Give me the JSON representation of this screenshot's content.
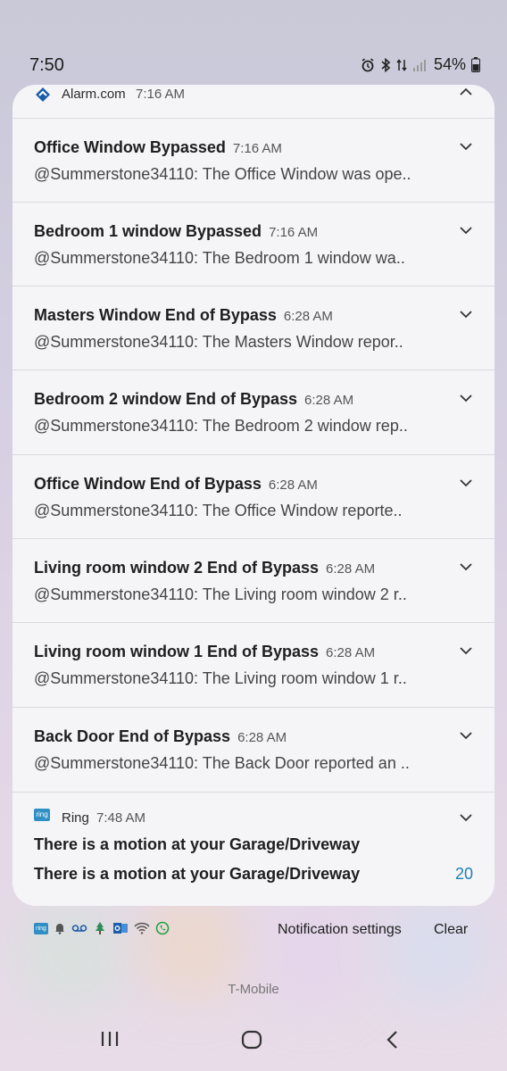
{
  "status_bar": {
    "time": "7:50",
    "battery_percent": "54%",
    "icons": [
      "alarm-icon",
      "bluetooth-icon",
      "data-arrows-icon",
      "signal-icon",
      "battery-icon"
    ]
  },
  "alarm_group": {
    "app_name": "Alarm.com",
    "time": "7:16 AM",
    "notifications": [
      {
        "title": "Office Window Bypassed",
        "time": "7:16 AM",
        "body": "@Summerstone34110: The Office Window was ope.."
      },
      {
        "title": "Bedroom 1 window Bypassed",
        "time": "7:16 AM",
        "body": "@Summerstone34110: The Bedroom 1 window wa.."
      },
      {
        "title": "Masters Window End of Bypass",
        "time": "6:28 AM",
        "body": "@Summerstone34110: The Masters Window repor.."
      },
      {
        "title": "Bedroom 2 window End of Bypass",
        "time": "6:28 AM",
        "body": "@Summerstone34110: The Bedroom 2 window rep.."
      },
      {
        "title": "Office Window End of Bypass",
        "time": "6:28 AM",
        "body": "@Summerstone34110: The Office Window reporte.."
      },
      {
        "title": "Living room window 2 End of Bypass",
        "time": "6:28 AM",
        "body": "@Summerstone34110: The Living room window 2 r.."
      },
      {
        "title": "Living room window 1 End of Bypass",
        "time": "6:28 AM",
        "body": "@Summerstone34110: The Living room window 1 r.."
      },
      {
        "title": "Back Door End of Bypass",
        "time": "6:28 AM",
        "body": "@Summerstone34110: The Back Door reported an .."
      }
    ]
  },
  "ring_group": {
    "icon_text": "ring",
    "app_name": "Ring",
    "time": "7:48 AM",
    "message_1": "There is a motion at your Garage/Driveway",
    "message_2": "There is a motion at your Garage/Driveway",
    "count": "20"
  },
  "footer": {
    "notification_settings": "Notification settings",
    "clear": "Clear",
    "mini_icon_text": "ring"
  },
  "carrier": "T-Mobile",
  "colors": {
    "ring_blue": "#2f8fc5",
    "count_blue": "#1f7fb0",
    "alarm_blue": "#1c5fa8"
  }
}
